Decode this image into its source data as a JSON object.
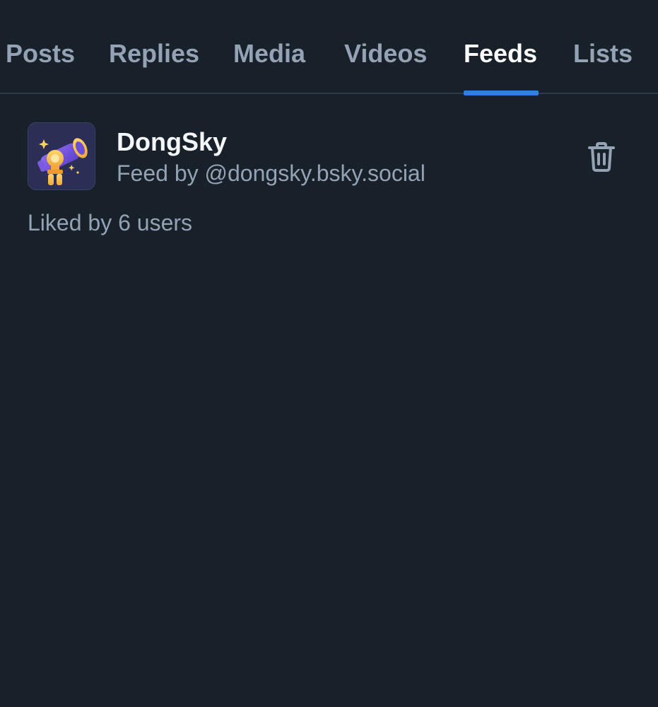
{
  "tabs": [
    {
      "label": "Posts",
      "active": false
    },
    {
      "label": "Replies",
      "active": false
    },
    {
      "label": "Media",
      "active": false
    },
    {
      "label": "Videos",
      "active": false
    },
    {
      "label": "Feeds",
      "active": true
    },
    {
      "label": "Lists",
      "active": false
    }
  ],
  "colors": {
    "background": "#18202a",
    "accent": "#2f7fe6",
    "muted_text": "#93a3b5",
    "primary_text": "#f4f6f9"
  },
  "feed": {
    "title": "DongSky",
    "subtitle": "Feed by @dongsky.bsky.social",
    "likes": "Liked by 6 users",
    "avatar_icon": "telescope-icon",
    "action_icon": "trash-icon"
  }
}
